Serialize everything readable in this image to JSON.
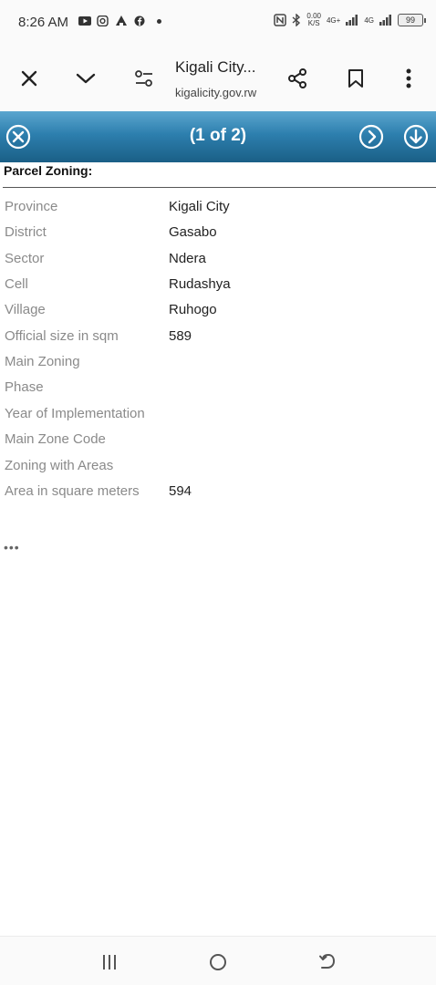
{
  "status_bar": {
    "time": "8:26 AM",
    "left_icons": [
      "youtube-icon",
      "instagram-icon",
      "notification-icon",
      "facebook-icon"
    ],
    "net_speed_value": "0.00",
    "net_speed_unit": "K/S",
    "signal1_label": "4G+",
    "signal2_label": "4G",
    "battery": "99"
  },
  "browser": {
    "title": "Kigali City...",
    "url": "kigalicity.gov.rw"
  },
  "popup": {
    "counter": "(1 of 2)",
    "header_color": "#2d7fae"
  },
  "section": {
    "title": "Parcel Zoning:"
  },
  "attributes": [
    {
      "label": "Province",
      "value": "Kigali City"
    },
    {
      "label": "District",
      "value": "Gasabo"
    },
    {
      "label": "Sector",
      "value": "Ndera"
    },
    {
      "label": "Cell",
      "value": "Rudashya"
    },
    {
      "label": "Village",
      "value": "Ruhogo"
    },
    {
      "label": "Official size in sqm",
      "value": "589"
    },
    {
      "label": "Main Zoning",
      "value": ""
    },
    {
      "label": "Phase",
      "value": ""
    },
    {
      "label": "Year of Implementation",
      "value": ""
    },
    {
      "label": "Main Zone Code",
      "value": ""
    },
    {
      "label": "Zoning with Areas",
      "value": ""
    },
    {
      "label": "Area in square meters",
      "value": "594"
    }
  ],
  "more": "•••"
}
